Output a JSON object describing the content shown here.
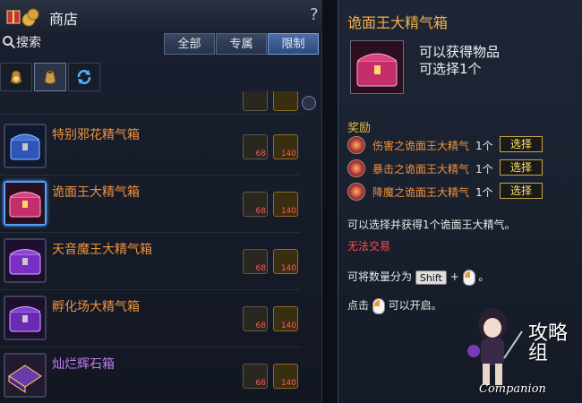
{
  "shop": {
    "title": "商店",
    "help": "?",
    "search_placeholder": "搜索",
    "filter_tabs": [
      "全部",
      "专属",
      "限制"
    ],
    "active_filter": 2,
    "category_tabs": [
      "gold-pouch-icon",
      "item-pouch-icon",
      "refresh-icon"
    ],
    "active_category": 1,
    "items": [
      {
        "name": "特别邪花精气箱",
        "color": "#f0923e",
        "cost1": "68",
        "cost2": "140",
        "icon": "blue-chest-icon"
      },
      {
        "name": "诡面王大精气箱",
        "color": "#f0923e",
        "cost1": "68",
        "cost2": "140",
        "icon": "pink-chest-icon",
        "selected": true
      },
      {
        "name": "天音魔王大精气箱",
        "color": "#f0923e",
        "cost1": "68",
        "cost2": "140",
        "icon": "purple-chest-icon"
      },
      {
        "name": "孵化场大精气箱",
        "color": "#f0923e",
        "cost1": "68",
        "cost2": "140",
        "icon": "purple-chest-icon"
      },
      {
        "name": "灿烂辉石箱",
        "color": "#c07cf0",
        "cost1": "68",
        "cost2": "140",
        "icon": "gold-box-icon"
      }
    ]
  },
  "tooltip": {
    "title": "诡面王大精气箱",
    "desc_line1": "可以获得物品",
    "desc_line2": "可选择1个",
    "reward_label": "奖励",
    "rewards": [
      {
        "name": "伤害之诡面王大精气",
        "count": "1个",
        "button": "选择"
      },
      {
        "name": "暴击之诡面王大精气",
        "count": "1个",
        "button": "选择"
      },
      {
        "name": "降魔之诡面王大精气",
        "count": "1个",
        "button": "选择"
      }
    ],
    "info": "可以选择并获得1个诡面王大精气。",
    "trade_warning": "无法交易",
    "split_prefix": "可将数量分为",
    "split_key": "Shift",
    "split_plus": "+",
    "split_suffix": "。",
    "open_prefix": "点击",
    "open_suffix": "可以开启。"
  },
  "watermark": {
    "chars": "攻略组",
    "companion": "Companion"
  }
}
